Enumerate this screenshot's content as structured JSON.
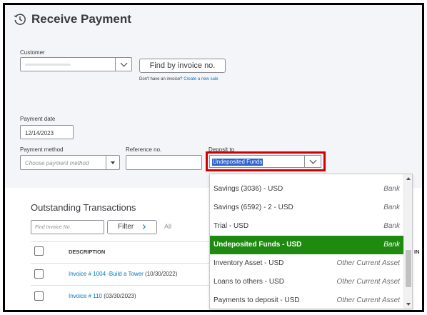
{
  "page": {
    "title": "Receive Payment",
    "icons": {
      "history": "history-clock-icon",
      "dropdown": "chevron-down-icon"
    }
  },
  "customer": {
    "label": "Customer",
    "value": "",
    "find_button": "Find by invoice no.",
    "no_invoice_text": "Don't have an invoice?",
    "create_sale_link": "Create a new sale"
  },
  "payment": {
    "date_label": "Payment date",
    "date_value": "12/14/2023",
    "method_label": "Payment method",
    "method_placeholder": "Choose payment method",
    "reference_label": "Reference no.",
    "reference_value": "",
    "deposit_label": "Deposit to",
    "deposit_value": "Undeposited Funds"
  },
  "deposit_dropdown": {
    "options": [
      {
        "name": "Savings (3036)  - USD",
        "type": "Bank",
        "selected": false
      },
      {
        "name": "Savings (6592) - 2  - USD",
        "type": "Bank",
        "selected": false
      },
      {
        "name": "Trial  - USD",
        "type": "Bank",
        "selected": false
      },
      {
        "name": "Undeposited Funds  - USD",
        "type": "Bank",
        "selected": true
      },
      {
        "name": "Inventory Asset  - USD",
        "type": "Other Current Asset",
        "selected": false
      },
      {
        "name": "Loans to others  - USD",
        "type": "Other Current Asset",
        "selected": false
      },
      {
        "name": "Payments to deposit  - USD",
        "type": "Other Current Asset",
        "selected": false
      }
    ]
  },
  "outstanding": {
    "title": "Outstanding Transactions",
    "find_placeholder": "Find Invoice No.",
    "filter_label": "Filter",
    "all_label": "All",
    "column_description": "DESCRIPTION",
    "column_cut": "IN",
    "rows": [
      {
        "link": "Invoice # 1004 -Build a Tower",
        "date": "(10/30/2022)"
      },
      {
        "link": "Invoice # 110",
        "date": "(03/30/2023)"
      }
    ]
  },
  "colors": {
    "accent_link": "#0077c5",
    "selected_option": "#1e8a0f",
    "highlight_outline": "#d10000",
    "text_selection": "#2d62cf"
  }
}
